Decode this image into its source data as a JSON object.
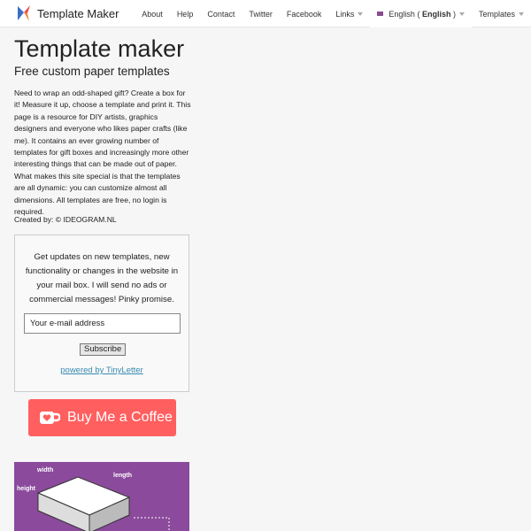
{
  "nav": {
    "brand": "Template Maker",
    "items": [
      "About",
      "Help",
      "Contact",
      "Twitter",
      "Facebook",
      "Links"
    ],
    "language": "English",
    "language_native": "English",
    "templates": "Templates"
  },
  "main": {
    "title": "Template maker",
    "subtitle": "Free custom paper templates",
    "intro": "Need to wrap an odd-shaped gift? Create a box for it! Measure it up, choose a template and print it. This page is a resource for DIY artists, graphics designers and everyone who likes paper crafts (like me). It contains an ever growing number of templates for gift boxes and increasingly more other interesting things that can be made out of paper. What makes this site special is that the templates are all dynamic: you can customize almost all dimensions. All templates are free, no login is required.",
    "created": "Created by: © IDEOGRAM.NL"
  },
  "newsletter": {
    "text": "Get updates on new templates, new functionality or changes in the website in your mail box. I will send no ads or commercial messages! Pinky promise.",
    "email_placeholder": "Your e-mail address",
    "subscribe": "Subscribe",
    "powered": "powered by TinyLetter"
  },
  "coffee": {
    "label": "Buy Me a Coffee",
    "color": "#ff5f5f"
  },
  "promo": {
    "width": "width",
    "length": "length",
    "height": "height"
  }
}
